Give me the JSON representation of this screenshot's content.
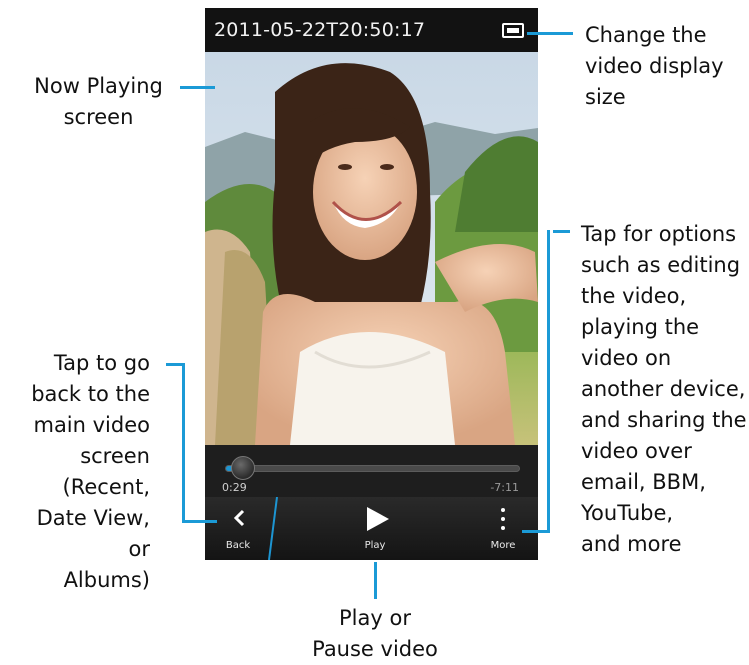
{
  "player": {
    "timestamp": "2011-05-22T20:50:17",
    "elapsed": "0:29",
    "remaining": "-7:11",
    "progress_fraction": 0.06,
    "actions": {
      "back": "Back",
      "play": "Play",
      "more": "More"
    }
  },
  "callouts": {
    "now_playing": [
      "Now Playing",
      "screen"
    ],
    "display_size": [
      "Change the",
      "video display",
      "size"
    ],
    "options": [
      "Tap for options",
      "such as editing",
      "the video,",
      "playing the",
      "video on",
      "another device,",
      "and sharing the",
      "video over",
      "email, BBM,",
      "YouTube,",
      "and more"
    ],
    "back": [
      "Tap to go",
      "back to the",
      "main video",
      "screen",
      "(Recent,",
      "Date View, or",
      "Albums)"
    ],
    "play": [
      "Play or",
      "Pause video"
    ]
  },
  "colors": {
    "accent": "#1b9ad6",
    "bar_bg": "#121212"
  },
  "icons": {
    "size": "display-size-icon",
    "back": "chevron-left-icon",
    "play": "play-triangle-icon",
    "more": "vertical-dots-icon"
  }
}
